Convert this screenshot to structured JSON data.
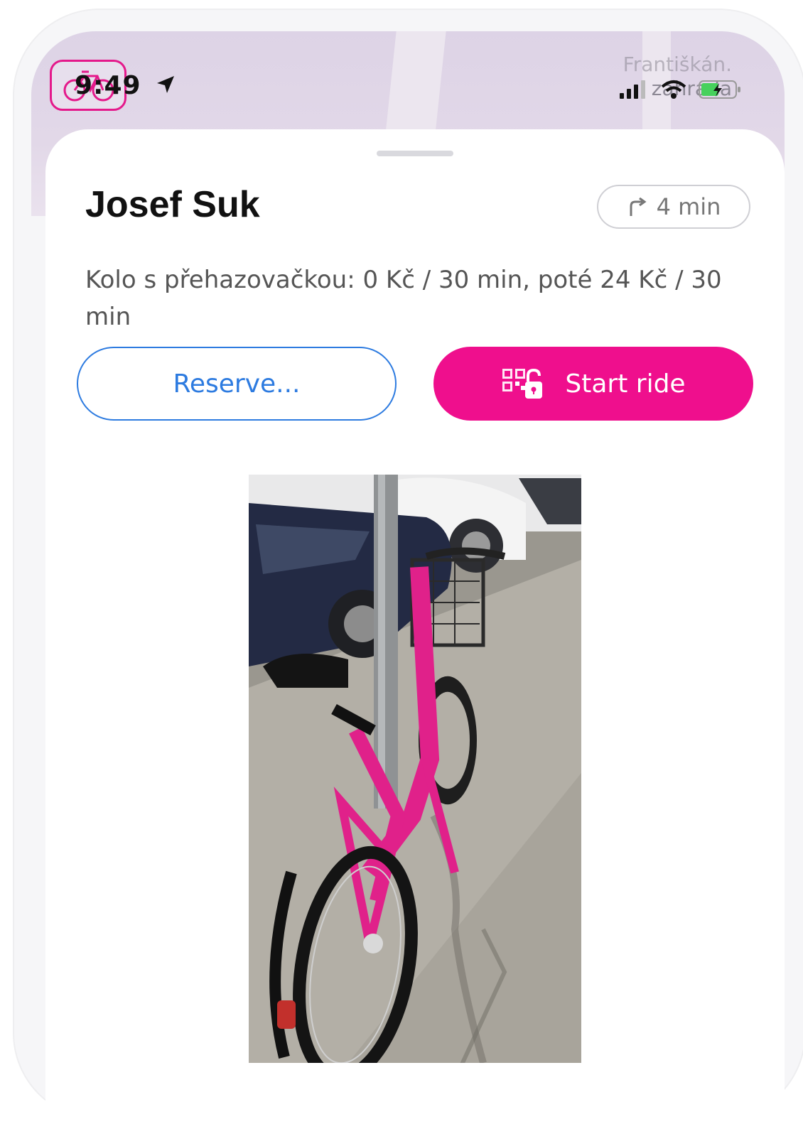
{
  "status_bar": {
    "time": "9:49",
    "location_icon": "location-arrow-icon",
    "signal_icon": "cellular-signal-icon",
    "wifi_icon": "wifi-icon",
    "battery_icon": "battery-charging-icon"
  },
  "map": {
    "place_label_line1": "Františkán.",
    "place_label_line2": "zahrada",
    "marker_icon": "bike-station-marker-icon"
  },
  "station": {
    "name": "Josef Suk",
    "eta": "4 min",
    "eta_icon": "turn-right-arrow-icon",
    "pricing": "Kolo s přehazovačkou: 0 Kč / 30 min, poté 24 Kč / 30 min"
  },
  "actions": {
    "reserve_label": "Reserve...",
    "start_label": "Start ride",
    "start_icon": "qr-unlock-icon"
  },
  "photo": {
    "description_icon": "bike-photo"
  },
  "colors": {
    "brand_pink": "#ef0f8d",
    "link_blue": "#2d7be0",
    "map_bg": "#ddd3e6"
  }
}
